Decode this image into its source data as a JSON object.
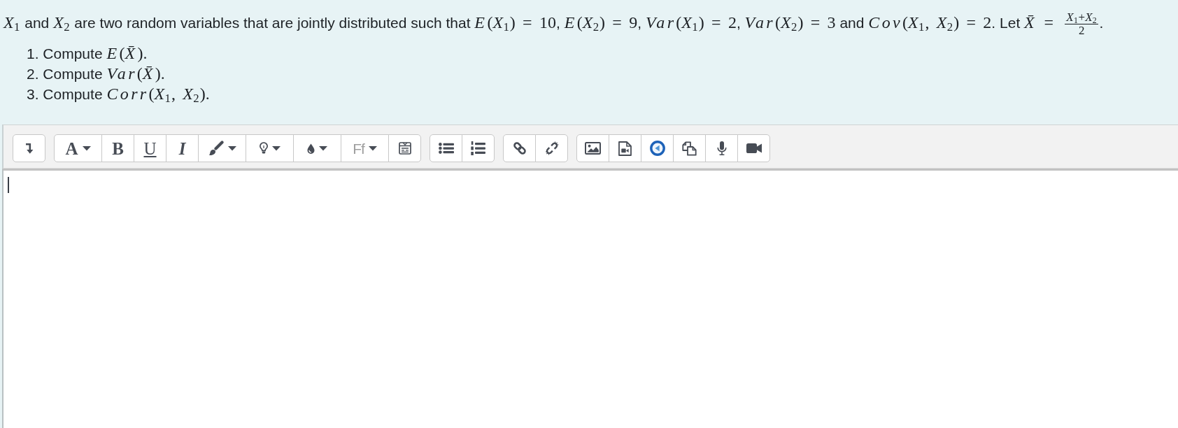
{
  "question": {
    "segments": [
      {
        "kind": "math",
        "text": "*X*$_{1}$"
      },
      {
        "kind": "text",
        "text": " and "
      },
      {
        "kind": "math",
        "text": "*X*$_{2}$"
      },
      {
        "kind": "text",
        "text": " are two random variables that are jointly distributed such that "
      },
      {
        "kind": "math",
        "text": "*E*(*X*$_{1}$) = 10"
      },
      {
        "kind": "text",
        "text": ", "
      },
      {
        "kind": "math",
        "text": "*E*(*X*$_{2}$) = 9"
      },
      {
        "kind": "text",
        "text": ", "
      },
      {
        "kind": "math",
        "text": "*Var*(*X*$_{1}$) = 2"
      },
      {
        "kind": "text",
        "text": ", "
      },
      {
        "kind": "math",
        "text": "*Var*(*X*$_{2}$) = 3"
      },
      {
        "kind": "text",
        "text": " and "
      },
      {
        "kind": "math",
        "text": "*Cov*(*X*$_{1}$, *X*$_{2}$) = 2"
      },
      {
        "kind": "text",
        "text": ". Let "
      },
      {
        "kind": "math",
        "text": "*X̄* = "
      },
      {
        "kind": "fraction",
        "numerator": "*X*$_{1}$+*X*$_{2}$",
        "denominator": "2"
      },
      {
        "kind": "text",
        "text": "."
      }
    ],
    "items": [
      {
        "segments": [
          {
            "kind": "text",
            "text": "1. Compute "
          },
          {
            "kind": "math",
            "text": "*E*(*X̄*)."
          }
        ]
      },
      {
        "segments": [
          {
            "kind": "text",
            "text": "2. Compute "
          },
          {
            "kind": "math",
            "text": "*Var*(*X̄*)."
          }
        ]
      },
      {
        "segments": [
          {
            "kind": "text",
            "text": "3. Compute "
          },
          {
            "kind": "math",
            "text": "*Corr*(*X*$_{1}$, *X*$_{2}$)."
          }
        ]
      }
    ]
  },
  "editor": {
    "toolbar": {
      "groups": [
        {
          "buttons": [
            {
              "kind": "toggle",
              "dropdown": false
            }
          ]
        },
        {
          "buttons": [
            {
              "kind": "font",
              "label": "A",
              "dropdown": true
            },
            {
              "kind": "bold",
              "label": "B",
              "dropdown": false
            },
            {
              "kind": "underline",
              "label": "U",
              "dropdown": false
            },
            {
              "kind": "italic",
              "label": "I",
              "dropdown": false
            },
            {
              "kind": "brush",
              "dropdown": true
            },
            {
              "kind": "bulb",
              "dropdown": true
            },
            {
              "kind": "drop",
              "dropdown": true
            },
            {
              "kind": "family",
              "label": "Ff",
              "dropdown": true
            },
            {
              "kind": "form",
              "dropdown": false
            }
          ]
        },
        {
          "buttons": [
            {
              "kind": "bullets",
              "dropdown": false
            },
            {
              "kind": "numbers",
              "dropdown": false
            }
          ]
        },
        {
          "buttons": [
            {
              "kind": "link",
              "dropdown": false
            },
            {
              "kind": "unlink",
              "dropdown": false
            }
          ]
        },
        {
          "buttons": [
            {
              "kind": "image",
              "dropdown": false
            },
            {
              "kind": "video-file",
              "dropdown": false
            },
            {
              "kind": "media",
              "dropdown": false
            },
            {
              "kind": "pages",
              "dropdown": false
            },
            {
              "kind": "microphone",
              "dropdown": false
            },
            {
              "kind": "camera",
              "dropdown": false
            }
          ]
        }
      ]
    },
    "focused": true
  }
}
